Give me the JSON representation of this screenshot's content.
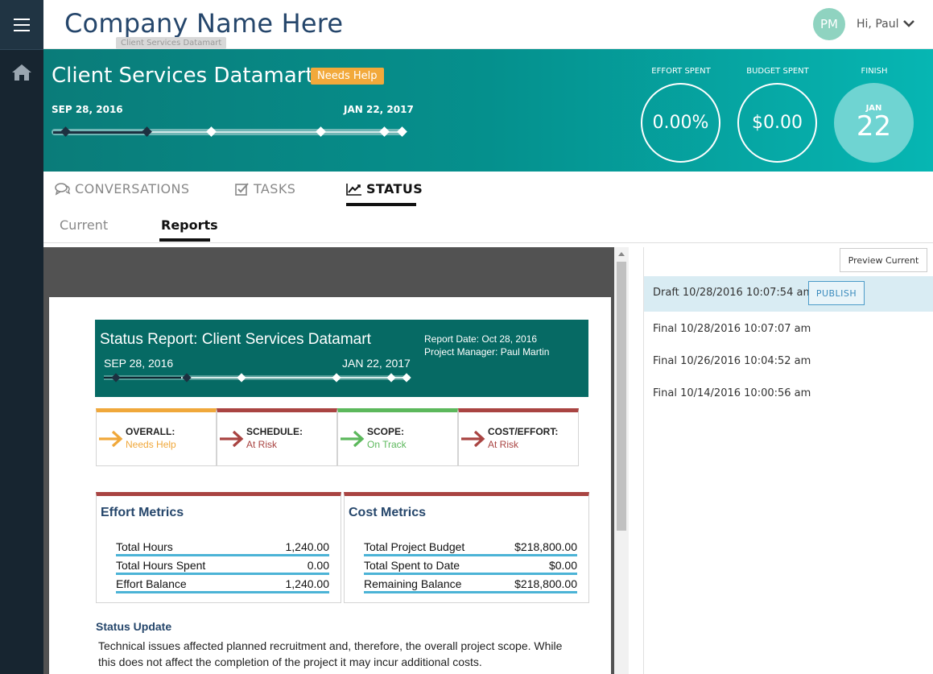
{
  "header": {
    "company": "Company Name Here",
    "tooltip": "Client Services Datamart",
    "avatar_initials": "PM",
    "greeting": "Hi, Paul"
  },
  "project": {
    "title": "Client Services Datamart",
    "status_badge": "Needs Help",
    "start_date": "SEP 28, 2016",
    "end_date": "JAN 22, 2017",
    "timeline_milestones": [
      0.04,
      0.27,
      0.45,
      0.76,
      0.94,
      0.99
    ],
    "timeline_progress": 0.27,
    "metrics": [
      {
        "label": "EFFORT SPENT",
        "value": "0.00%"
      },
      {
        "label": "BUDGET SPENT",
        "value": "$0.00"
      }
    ],
    "finish": {
      "label": "FINISH",
      "month": "JAN",
      "day": "22"
    }
  },
  "tabs": [
    {
      "label": "CONVERSATIONS",
      "icon": "comments-icon"
    },
    {
      "label": "TASKS",
      "icon": "checkbox-icon"
    },
    {
      "label": "STATUS",
      "icon": "line-chart-icon",
      "active": true
    }
  ],
  "subtabs": [
    {
      "label": "Current"
    },
    {
      "label": "Reports",
      "active": true
    }
  ],
  "report": {
    "title": "Status Report: Client Services Datamart",
    "report_date": "Report Date: Oct 28, 2016",
    "project_manager": "Project Manager: Paul Martin",
    "start_date": "SEP 28, 2016",
    "end_date": "JAN 22, 2017",
    "statuses": [
      {
        "title": "OVERALL:",
        "value": "Needs Help",
        "color": "#f0a83b"
      },
      {
        "title": "SCHEDULE:",
        "value": "At Risk",
        "color": "#a94442"
      },
      {
        "title": "SCOPE:",
        "value": "On Track",
        "color": "#5cb85c"
      },
      {
        "title": "COST/EFFORT:",
        "value": "At Risk",
        "color": "#a94442"
      }
    ],
    "effort": {
      "title": "Effort Metrics",
      "rows": [
        {
          "k": "Total Hours",
          "v": "1,240.00"
        },
        {
          "k": "Total Hours Spent",
          "v": "0.00"
        },
        {
          "k": "Effort Balance",
          "v": "1,240.00"
        }
      ]
    },
    "cost": {
      "title": "Cost Metrics",
      "rows": [
        {
          "k": "Total Project Budget",
          "v": "$218,800.00"
        },
        {
          "k": "Total Spent to Date",
          "v": "$0.00"
        },
        {
          "k": "Remaining Balance",
          "v": "$218,800.00"
        }
      ]
    },
    "status_update_title": "Status Update",
    "status_update_text": "Technical issues affected planned recruitment and, therefore, the overall project scope. While this does not affect the completion of the project it may incur additional costs."
  },
  "versions_panel": {
    "preview_label": "Preview Current",
    "publish_label": "PUBLISH",
    "versions": [
      {
        "label": "Draft 10/28/2016 10:07:54 am",
        "selected": true
      },
      {
        "label": "Final 10/28/2016 10:07:07 am"
      },
      {
        "label": "Final 10/26/2016 10:04:52 am"
      },
      {
        "label": "Final 10/14/2016 10:00:56 am"
      }
    ]
  },
  "colors": {
    "navy": "#25466b",
    "teal": "#066a64",
    "accent_blue": "#4bb3d6"
  }
}
